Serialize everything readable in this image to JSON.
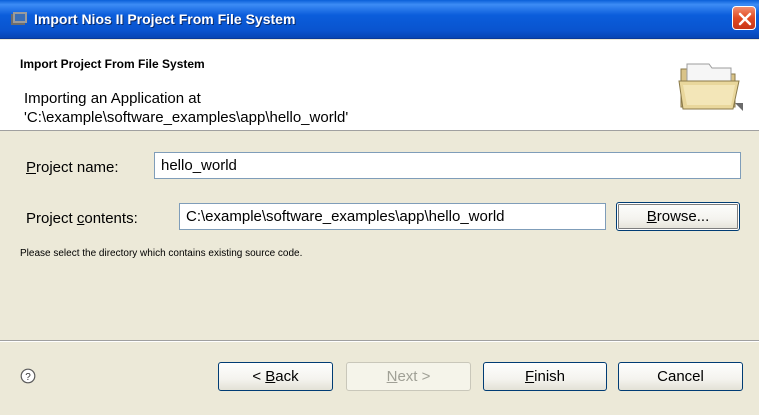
{
  "window": {
    "title": "Import Nios II Project From File System"
  },
  "header": {
    "title": "Import Project From File System",
    "message_line1": "Importing an Application at",
    "message_line2": "'C:\\example\\software_examples\\app\\hello_world'"
  },
  "form": {
    "project_name_label_prefix": "P",
    "project_name_label_rest": "roject name:",
    "project_name_value": "hello_world",
    "project_contents_label_prefix": "Project ",
    "project_contents_label_underlined": "c",
    "project_contents_label_rest": "ontents:",
    "project_contents_value": "C:\\example\\software_examples\\app\\hello_world",
    "browse_u": "B",
    "browse_rest": "rowse...",
    "hint": "Please select the directory which contains existing source code."
  },
  "footer": {
    "help_icon_text": "?",
    "back_prefix": "< ",
    "back_u": "B",
    "back_rest": "ack",
    "next_u": "N",
    "next_rest": "ext >",
    "finish_u": "F",
    "finish_rest": "inish",
    "cancel": "Cancel"
  },
  "icons": {
    "title": "app-icon",
    "close": "close-icon",
    "folder": "folder-open-icon",
    "help": "help-icon"
  },
  "colors": {
    "titlebar": "#0a54cf",
    "close": "#e24a22",
    "background": "#ece9d8"
  }
}
